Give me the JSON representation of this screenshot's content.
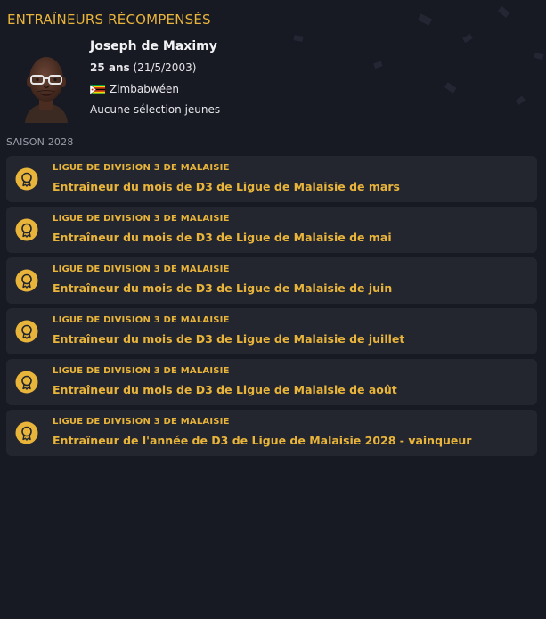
{
  "panel": {
    "title": "ENTRAÎNEURS RÉCOMPENSÉS"
  },
  "coach": {
    "name": "Joseph de Maximy",
    "age": "25 ans",
    "birthdate": "(21/5/2003)",
    "nationality": "Zimbabwéen",
    "flag_icon": "zimbabwe-flag-icon",
    "youth_caps": "Aucune sélection jeunes"
  },
  "season": {
    "label": "SAISON 2028"
  },
  "awards": [
    {
      "competition": "LIGUE DE DIVISION 3 DE MALAISIE",
      "name": "Entraîneur du mois de D3 de Ligue de Malaisie de mars"
    },
    {
      "competition": "LIGUE DE DIVISION 3 DE MALAISIE",
      "name": "Entraîneur du mois de D3 de Ligue de Malaisie de mai"
    },
    {
      "competition": "LIGUE DE DIVISION 3 DE MALAISIE",
      "name": "Entraîneur du mois de D3 de Ligue de Malaisie de juin"
    },
    {
      "competition": "LIGUE DE DIVISION 3 DE MALAISIE",
      "name": "Entraîneur du mois de D3 de Ligue de Malaisie de juillet"
    },
    {
      "competition": "LIGUE DE DIVISION 3 DE MALAISIE",
      "name": "Entraîneur du mois de D3 de Ligue de Malaisie de août"
    },
    {
      "competition": "LIGUE DE DIVISION 3 DE MALAISIE",
      "name": "Entraîneur de l'année de D3 de Ligue de Malaisie 2028 - vainqueur"
    }
  ],
  "colors": {
    "accent": "#e9b43a",
    "background": "#171a23",
    "card": "#23262f"
  },
  "icons": {
    "award": "medal-icon"
  }
}
